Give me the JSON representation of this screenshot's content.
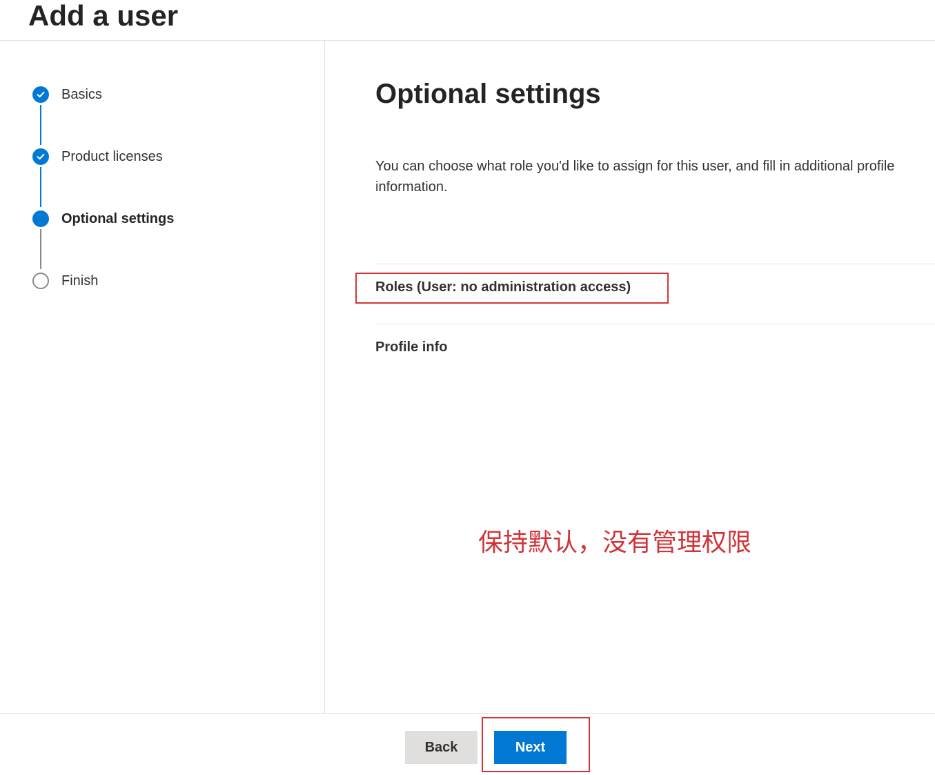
{
  "page": {
    "title": "Add a user"
  },
  "steps": [
    {
      "label": "Basics",
      "state": "done"
    },
    {
      "label": "Product licenses",
      "state": "done"
    },
    {
      "label": "Optional settings",
      "state": "current"
    },
    {
      "label": "Finish",
      "state": "todo"
    }
  ],
  "main": {
    "heading": "Optional settings",
    "description": "You can choose what role you'd like to assign for this user, and fill in additional profile information.",
    "roles_label": "Roles (User: no administration access)",
    "profile_label": "Profile info"
  },
  "annotation": {
    "text": "保持默认，没有管理权限"
  },
  "footer": {
    "back_label": "Back",
    "next_label": "Next"
  },
  "colors": {
    "accent": "#0078d4",
    "highlight": "#d13438",
    "pending": "#8a8886"
  }
}
